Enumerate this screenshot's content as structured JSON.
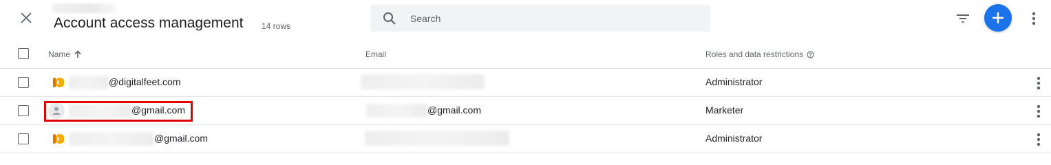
{
  "header": {
    "title": "Account access management",
    "row_count": "14 rows",
    "search_placeholder": "Search"
  },
  "table": {
    "columns": {
      "name": "Name",
      "email": "Email",
      "roles": "Roles and data restrictions"
    },
    "rows": [
      {
        "name_suffix": "@digitalfeet.com",
        "email_suffix": "",
        "role": "Administrator",
        "avatar": "analytics-logo-icon"
      },
      {
        "name_suffix": "@gmail.com",
        "email_suffix": "@gmail.com",
        "role": "Marketer",
        "avatar": "default-user-icon"
      },
      {
        "name_suffix": "@gmail.com",
        "email_suffix": "",
        "role": "Administrator",
        "avatar": "analytics-logo-icon"
      }
    ]
  },
  "colors": {
    "accent": "#1a73e8",
    "highlight": "#e00000",
    "logo_orange": "#f9ab00"
  }
}
